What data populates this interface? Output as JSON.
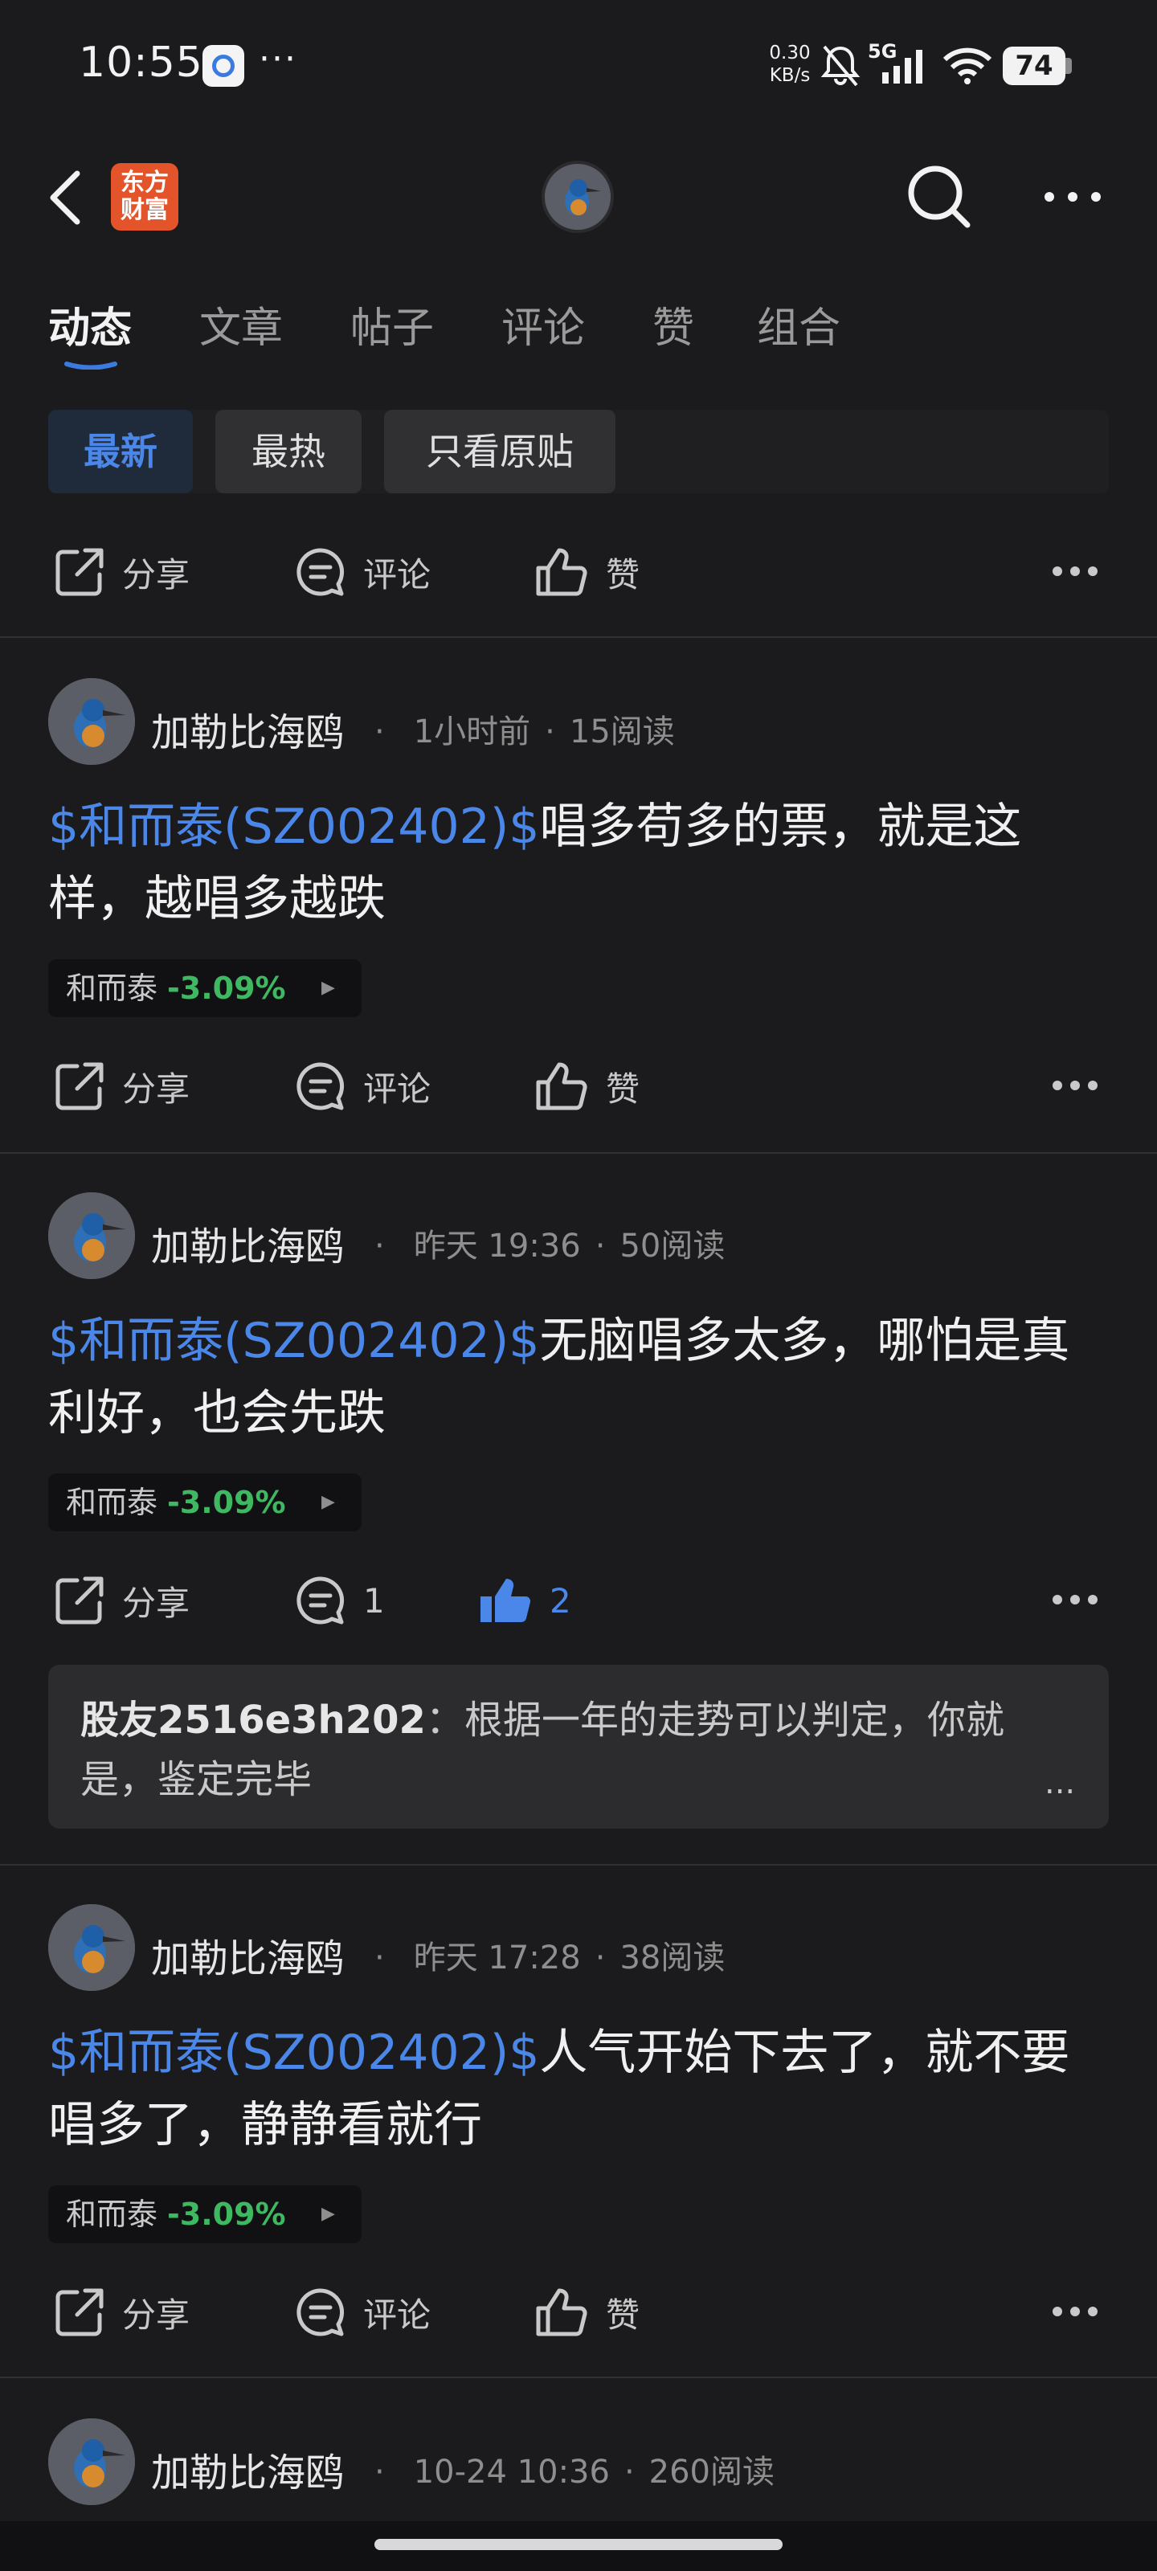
{
  "status_bar": {
    "time": "10:55",
    "overflow": "···",
    "net_speed_value": "0.30",
    "net_speed_unit": "KB/s",
    "network": "5G",
    "battery": "74"
  },
  "header": {
    "back_icon": "chevron-left-icon",
    "logo_line1": "东方",
    "logo_line2": "财富",
    "search_icon": "search-icon",
    "more_icon": "more-horizontal-icon"
  },
  "tabs": [
    {
      "label": "动态",
      "active": true
    },
    {
      "label": "文章",
      "active": false
    },
    {
      "label": "帖子",
      "active": false
    },
    {
      "label": "评论",
      "active": false
    },
    {
      "label": "赞",
      "active": false
    },
    {
      "label": "组合",
      "active": false
    }
  ],
  "filters": [
    {
      "label": "最新",
      "active": true
    },
    {
      "label": "最热",
      "active": false
    },
    {
      "label": "只看原贴",
      "active": false
    }
  ],
  "top_actions": {
    "share": "分享",
    "comment": "评论",
    "like": "赞"
  },
  "posts": [
    {
      "author": "加勒比海鸥",
      "time": "1小时前",
      "reads": "15阅读",
      "stock_tag": "$和而泰(SZ002402)$",
      "text": "唱多苟多的票，就是这样，越唱多越跌",
      "ticker_name": "和而泰",
      "ticker_change": "-3.09%",
      "share": "分享",
      "comment": "评论",
      "like": "赞"
    },
    {
      "author": "加勒比海鸥",
      "time": "昨天 19:36",
      "reads": "50阅读",
      "stock_tag": "$和而泰(SZ002402)$",
      "text": "无脑唱多太多，哪怕是真利好，也会先跌",
      "ticker_name": "和而泰",
      "ticker_change": "-3.09%",
      "share": "分享",
      "comment": "1",
      "like": "2",
      "comment_preview": {
        "user": "股友2516e3h202",
        "separator": "：",
        "text": "根据一年的走势可以判定，你就是，鉴定完毕",
        "more": "..."
      }
    },
    {
      "author": "加勒比海鸥",
      "time": "昨天 17:28",
      "reads": "38阅读",
      "stock_tag": "$和而泰(SZ002402)$",
      "text": "人气开始下去了，就不要唱多了，静静看就行",
      "ticker_name": "和而泰",
      "ticker_change": "-3.09%",
      "share": "分享",
      "comment": "评论",
      "like": "赞"
    },
    {
      "author": "加勒比海鸥",
      "time": "10-24 10:36",
      "reads": "260阅读"
    }
  ],
  "colors": {
    "background": "#1b1b1d",
    "accent_blue": "#4a87e8",
    "down_green": "#3fb862",
    "logo_orange": "#e4542a"
  }
}
